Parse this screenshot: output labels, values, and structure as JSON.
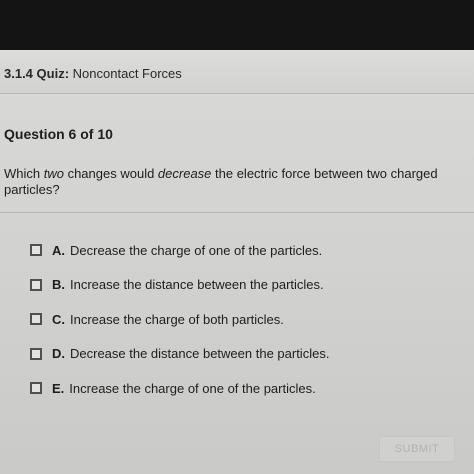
{
  "header": {
    "quiz_code": "3.1.4",
    "quiz_kind": "Quiz:",
    "quiz_name": "Noncontact Forces"
  },
  "question": {
    "counter": "Question 6 of 10",
    "prompt_part1": "Which ",
    "prompt_emph1": "two",
    "prompt_part2": " changes would ",
    "prompt_emph2": "decrease",
    "prompt_part3": " the electric force between two charged particles?"
  },
  "options": [
    {
      "letter": "A.",
      "text": "Decrease the charge of one of the particles.",
      "checked": false
    },
    {
      "letter": "B.",
      "text": "Increase the distance between the particles.",
      "checked": false
    },
    {
      "letter": "C.",
      "text": "Increase the charge of both particles.",
      "checked": false
    },
    {
      "letter": "D.",
      "text": "Decrease the distance between the particles.",
      "checked": false
    },
    {
      "letter": "E.",
      "text": "Increase the charge of one of the particles.",
      "checked": false
    }
  ],
  "submit_label": "SUBMIT"
}
